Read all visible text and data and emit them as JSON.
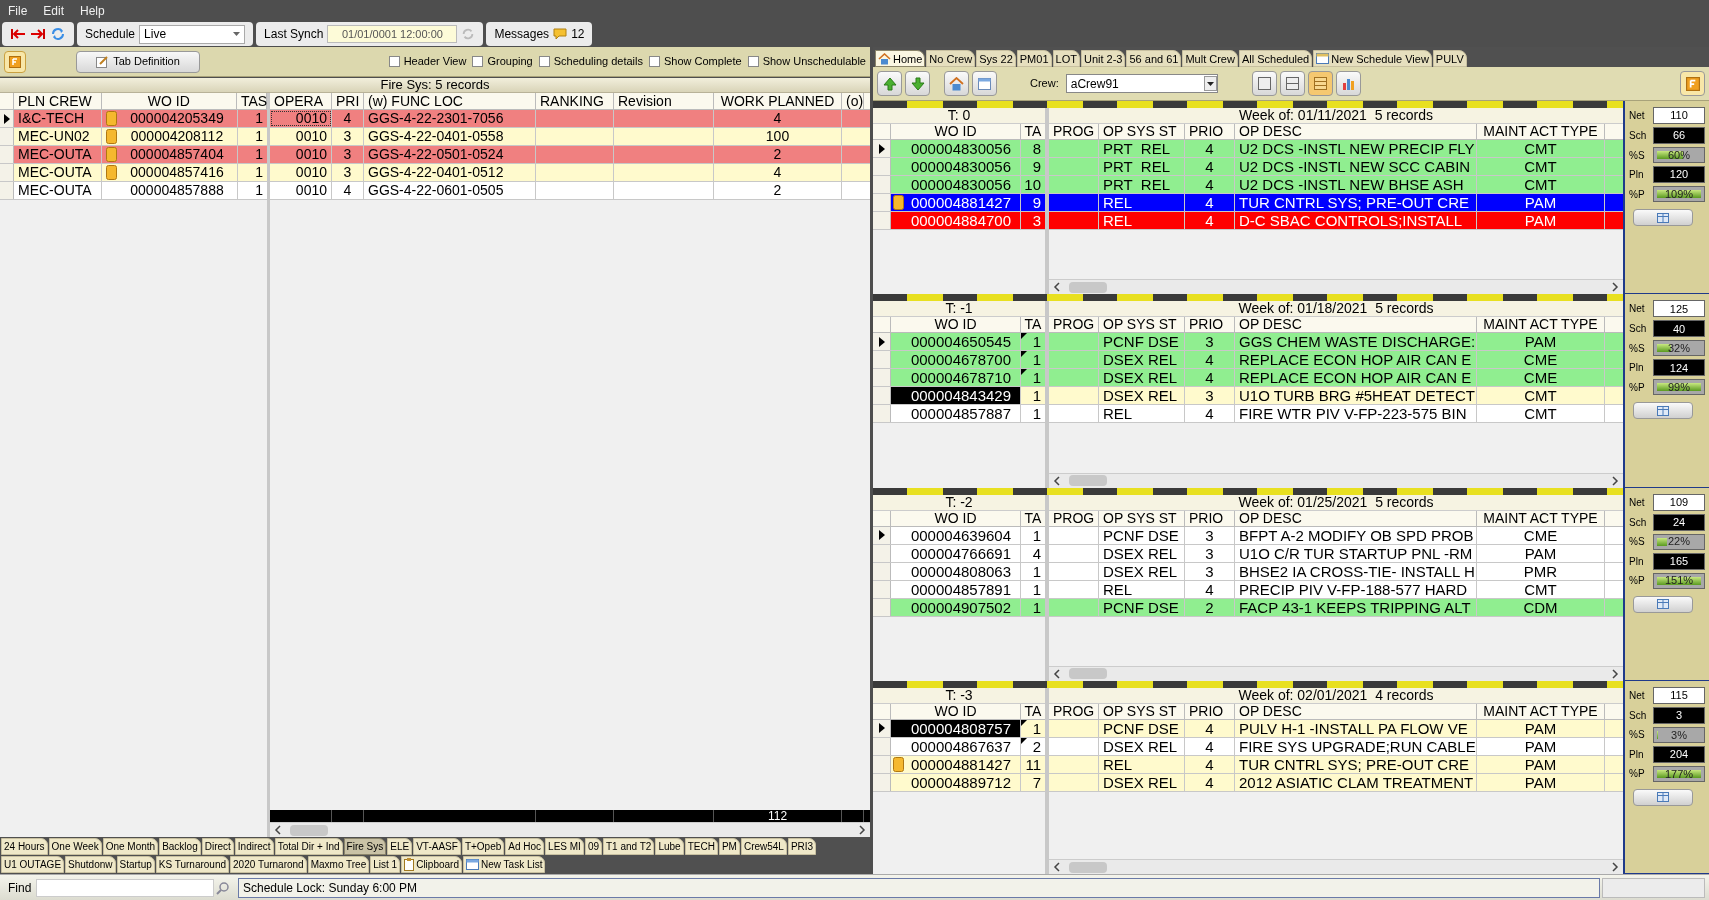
{
  "menu": [
    "File",
    "Edit",
    "Help"
  ],
  "toolbar": {
    "schedule_label": "Schedule",
    "schedule_value": "Live",
    "last_synch_label": "Last Synch",
    "last_synch_value": "01/01/0001 12:00:00",
    "messages_label": "Messages",
    "messages_count": "12"
  },
  "options": {
    "tab_definition": "Tab Definition",
    "checkboxes": [
      {
        "label": "Header View",
        "checked": false
      },
      {
        "label": "Grouping",
        "checked": false
      },
      {
        "label": "Scheduling details",
        "checked": false
      },
      {
        "label": "Show Complete",
        "checked": false
      },
      {
        "label": "Show Unschedulable",
        "checked": false
      }
    ]
  },
  "work_grid": {
    "title": "Fire Sys: 5 records",
    "frozen_columns": [
      "PLN CREW",
      "WO ID",
      "TAS"
    ],
    "columns": [
      "OPERA",
      "PRI",
      "(w) FUNC LOC",
      "RANKING",
      "Revision",
      "WORK PLANNED",
      "(o)"
    ],
    "rows": [
      {
        "crew": "I&C-TECH",
        "flag": true,
        "wo_id": "000004205349",
        "tas": "1",
        "opera": "0010",
        "pri": "4",
        "func_loc": "GGS-4-22-2301-7056",
        "work_planned": "4",
        "color": "#f08080",
        "current": true,
        "focused": true
      },
      {
        "crew": "MEC-UN02",
        "flag": true,
        "wo_id": "000004208112",
        "tas": "1",
        "opera": "0010",
        "pri": "3",
        "func_loc": "GGS-4-22-0401-0558",
        "work_planned": "100",
        "color": "#fffacd",
        "current": false,
        "focused": false
      },
      {
        "crew": "MEC-OUTA",
        "flag": true,
        "wo_id": "000004857404",
        "tas": "1",
        "opera": "0010",
        "pri": "3",
        "func_loc": "GGS-4-22-0501-0524",
        "work_planned": "2",
        "color": "#f08080",
        "current": false,
        "focused": false
      },
      {
        "crew": "MEC-OUTA",
        "flag": true,
        "wo_id": "000004857416",
        "tas": "1",
        "opera": "0010",
        "pri": "3",
        "func_loc": "GGS-4-22-0401-0512",
        "work_planned": "4",
        "color": "#fffacd",
        "current": false,
        "focused": false
      },
      {
        "crew": "MEC-OUTA",
        "flag": false,
        "wo_id": "000004857888",
        "tas": "1",
        "opera": "0010",
        "pri": "4",
        "func_loc": "GGS-4-22-0601-0505",
        "work_planned": "2",
        "color": "#ffffff",
        "current": false,
        "focused": false
      }
    ],
    "total_work_planned": "112"
  },
  "list_tabs": [
    [
      {
        "label": "24 Hours",
        "selected": false,
        "kind": "plain"
      },
      {
        "label": "One Week",
        "selected": false,
        "kind": "plain"
      },
      {
        "label": "One Month",
        "selected": false,
        "kind": "plain"
      },
      {
        "label": "Backlog",
        "selected": false,
        "kind": "plain"
      },
      {
        "label": "Direct",
        "selected": false,
        "kind": "plain"
      },
      {
        "label": "Indirect",
        "selected": false,
        "kind": "plain"
      },
      {
        "label": "Total Dir + Ind",
        "selected": false,
        "kind": "plain"
      },
      {
        "label": "Fire Sys",
        "selected": true,
        "kind": "plain"
      },
      {
        "label": "ELE",
        "selected": false,
        "kind": "plain"
      },
      {
        "label": "VT-AASF",
        "selected": false,
        "kind": "plain"
      },
      {
        "label": "T+Opeb",
        "selected": false,
        "kind": "plain"
      },
      {
        "label": "Ad Hoc",
        "selected": false,
        "kind": "plain"
      },
      {
        "label": "LES MI",
        "selected": false,
        "kind": "plain"
      },
      {
        "label": "09",
        "selected": false,
        "kind": "plain"
      },
      {
        "label": "T1 and T2",
        "selected": false,
        "kind": "plain"
      },
      {
        "label": "Lube",
        "selected": false,
        "kind": "plain"
      },
      {
        "label": "TECH",
        "selected": false,
        "kind": "plain"
      },
      {
        "label": "PM",
        "selected": false,
        "kind": "plain"
      },
      {
        "label": "Crew54L",
        "selected": false,
        "kind": "plain"
      },
      {
        "label": "PRI3",
        "selected": false,
        "kind": "plain"
      }
    ],
    [
      {
        "label": "U1 OUTAGE",
        "selected": false,
        "kind": "plain"
      },
      {
        "label": "Shutdonw",
        "selected": false,
        "kind": "plain"
      },
      {
        "label": "Startup",
        "selected": false,
        "kind": "plain"
      },
      {
        "label": "KS Turnaround",
        "selected": false,
        "kind": "plain"
      },
      {
        "label": "2020 Turnarond",
        "selected": false,
        "kind": "plain"
      },
      {
        "label": "Maxmo Tree",
        "selected": false,
        "kind": "plain"
      },
      {
        "label": "List 1",
        "selected": false,
        "kind": "plain"
      },
      {
        "label": "Clipboard",
        "selected": false,
        "kind": "clipboard"
      },
      {
        "label": "New Task List",
        "selected": false,
        "kind": "window"
      }
    ]
  ],
  "schedule_tabs": [
    {
      "label": "Home",
      "selected": true,
      "kind": "home"
    },
    {
      "label": "No Crew",
      "selected": false,
      "kind": "plain"
    },
    {
      "label": "Sys 22",
      "selected": false,
      "kind": "plain"
    },
    {
      "label": "PM01",
      "selected": false,
      "kind": "plain"
    },
    {
      "label": "LOT",
      "selected": false,
      "kind": "plain"
    },
    {
      "label": "Unit 2-3",
      "selected": false,
      "kind": "plain"
    },
    {
      "label": "56 and 61",
      "selected": false,
      "kind": "plain"
    },
    {
      "label": "Mult Crew",
      "selected": false,
      "kind": "plain"
    },
    {
      "label": "All Scheduled",
      "selected": false,
      "kind": "plain"
    },
    {
      "label": "New Schedule View",
      "selected": false,
      "kind": "window"
    },
    {
      "label": "PULV",
      "selected": false,
      "kind": "plain"
    }
  ],
  "crew": {
    "label": "Crew:",
    "value": "aCrew91"
  },
  "weeks": [
    {
      "title": "T: 0",
      "heading": "Week of: 01/11/2021  5 records",
      "frozen_columns": [
        "WO ID",
        "TA"
      ],
      "columns": [
        "PROG",
        "OP SYS ST",
        "PRIO",
        "OP DESC",
        "MAINT ACT TYPE"
      ],
      "stats": [
        {
          "kind": "value",
          "label": "Net",
          "value": "110"
        },
        {
          "kind": "dark",
          "label": "Sch",
          "value": "66"
        },
        {
          "kind": "bar",
          "label": "%S",
          "value": "60%",
          "level": 0.6
        },
        {
          "kind": "dark",
          "label": "Pln",
          "value": "120"
        },
        {
          "kind": "bar",
          "label": "%P",
          "value": "109%",
          "level": 1
        }
      ],
      "rows": [
        {
          "wo_id": "000004830056",
          "ta": "8",
          "op_sys_st": "PRT  REL",
          "prio": "4",
          "op_desc": "U2 DCS -INSTL NEW PRECIP FLY",
          "maint_act_type": "CMT",
          "color": "#90ee90",
          "current": true,
          "flag": false,
          "wo_selected": false,
          "note": false
        },
        {
          "wo_id": "000004830056",
          "ta": "9",
          "op_sys_st": "PRT  REL",
          "prio": "4",
          "op_desc": "U2 DCS -INSTL NEW SCC CABIN",
          "maint_act_type": "CMT",
          "color": "#90ee90",
          "current": false,
          "flag": false,
          "wo_selected": false,
          "note": false
        },
        {
          "wo_id": "000004830056",
          "ta": "10",
          "op_sys_st": "PRT  REL",
          "prio": "4",
          "op_desc": "U2 DCS -INSTL NEW BHSE ASH",
          "maint_act_type": "CMT",
          "color": "#90ee90",
          "current": false,
          "flag": false,
          "wo_selected": false,
          "note": false
        },
        {
          "wo_id": "000004881427",
          "ta": "9",
          "op_sys_st": "REL",
          "prio": "4",
          "op_desc": "TUR CNTRL SYS; PRE-OUT CRE",
          "maint_act_type": "PAM",
          "color": "#0000ff",
          "current": false,
          "flag": true,
          "wo_selected": false,
          "note": false
        },
        {
          "wo_id": "000004884700",
          "ta": "3",
          "op_sys_st": "REL",
          "prio": "4",
          "op_desc": "D-C SBAC CONTROLS;INSTALL",
          "maint_act_type": "PAM",
          "color": "#ff0000",
          "current": false,
          "flag": false,
          "wo_selected": false,
          "note": false
        }
      ]
    },
    {
      "title": "T: -1",
      "heading": "Week of: 01/18/2021  5 records",
      "frozen_columns": [
        "WO ID",
        "TA"
      ],
      "columns": [
        "PROG",
        "OP SYS ST",
        "PRIO",
        "OP DESC",
        "MAINT ACT TYPE"
      ],
      "stats": [
        {
          "kind": "value",
          "label": "Net",
          "value": "125"
        },
        {
          "kind": "dark",
          "label": "Sch",
          "value": "40"
        },
        {
          "kind": "bar",
          "label": "%S",
          "value": "32%",
          "level": 0.32
        },
        {
          "kind": "dark",
          "label": "Pln",
          "value": "124"
        },
        {
          "kind": "bar",
          "label": "%P",
          "value": "99%",
          "level": 0.99
        }
      ],
      "rows": [
        {
          "wo_id": "000004650545",
          "ta": "1",
          "op_sys_st": "PCNF DSE",
          "prio": "3",
          "op_desc": "GGS CHEM WASTE DISCHARGE:",
          "maint_act_type": "PAM",
          "color": "#90ee90",
          "current": true,
          "flag": false,
          "wo_selected": false,
          "note": true
        },
        {
          "wo_id": "000004678700",
          "ta": "1",
          "op_sys_st": "DSEX REL",
          "prio": "4",
          "op_desc": "REPLACE ECON HOP AIR CAN E",
          "maint_act_type": "CME",
          "color": "#90ee90",
          "current": false,
          "flag": false,
          "wo_selected": false,
          "note": true
        },
        {
          "wo_id": "000004678710",
          "ta": "1",
          "op_sys_st": "DSEX REL",
          "prio": "4",
          "op_desc": "REPLACE ECON HOP AIR CAN E",
          "maint_act_type": "CME",
          "color": "#90ee90",
          "current": false,
          "flag": false,
          "wo_selected": false,
          "note": true
        },
        {
          "wo_id": "000004843429",
          "ta": "1",
          "op_sys_st": "DSEX REL",
          "prio": "3",
          "op_desc": "U1O TURB BRG #5HEAT DETECT",
          "maint_act_type": "CMT",
          "color": "#fffacd",
          "current": false,
          "flag": false,
          "wo_selected": true,
          "note": false
        },
        {
          "wo_id": "000004857887",
          "ta": "1",
          "op_sys_st": "REL",
          "prio": "4",
          "op_desc": "FIRE WTR PIV V-FP-223-575 BIN",
          "maint_act_type": "CMT",
          "color": "#ffffff",
          "current": false,
          "flag": false,
          "wo_selected": false,
          "note": false
        }
      ]
    },
    {
      "title": "T: -2",
      "heading": "Week of: 01/25/2021  5 records",
      "frozen_columns": [
        "WO ID",
        "TA"
      ],
      "columns": [
        "PROG",
        "OP SYS ST",
        "PRIO",
        "OP DESC",
        "MAINT ACT TYPE"
      ],
      "stats": [
        {
          "kind": "value",
          "label": "Net",
          "value": "109"
        },
        {
          "kind": "dark",
          "label": "Sch",
          "value": "24"
        },
        {
          "kind": "bar",
          "label": "%S",
          "value": "22%",
          "level": 0.22
        },
        {
          "kind": "dark",
          "label": "Pln",
          "value": "165"
        },
        {
          "kind": "bar",
          "label": "%P",
          "value": "151%",
          "level": 1
        }
      ],
      "rows": [
        {
          "wo_id": "000004639604",
          "ta": "1",
          "op_sys_st": "PCNF DSE",
          "prio": "3",
          "op_desc": "BFPT A-2 MODIFY OB SPD PROB",
          "maint_act_type": "CME",
          "color": "#ffffff",
          "current": true,
          "flag": false,
          "wo_selected": false,
          "note": false
        },
        {
          "wo_id": "000004766691",
          "ta": "4",
          "op_sys_st": "DSEX REL",
          "prio": "3",
          "op_desc": "U1O C/R TUR STARTUP PNL -RM",
          "maint_act_type": "PAM",
          "color": "#ffffff",
          "current": false,
          "flag": false,
          "wo_selected": false,
          "note": false
        },
        {
          "wo_id": "000004808063",
          "ta": "1",
          "op_sys_st": "DSEX REL",
          "prio": "3",
          "op_desc": "BHSE2 IA CROSS-TIE- INSTALL H",
          "maint_act_type": "PMR",
          "color": "#ffffff",
          "current": false,
          "flag": false,
          "wo_selected": false,
          "note": false
        },
        {
          "wo_id": "000004857891",
          "ta": "1",
          "op_sys_st": "REL",
          "prio": "4",
          "op_desc": "PRECIP PIV V-FP-188-577 HARD",
          "maint_act_type": "CMT",
          "color": "#ffffff",
          "current": false,
          "flag": false,
          "wo_selected": false,
          "note": false
        },
        {
          "wo_id": "000004907502",
          "ta": "1",
          "op_sys_st": "PCNF DSE",
          "prio": "2",
          "op_desc": "FACP 43-1 KEEPS TRIPPING ALT",
          "maint_act_type": "CDM",
          "color": "#90ee90",
          "current": false,
          "flag": false,
          "wo_selected": false,
          "note": false
        }
      ]
    },
    {
      "title": "T: -3",
      "heading": "Week of: 02/01/2021  4 records",
      "frozen_columns": [
        "WO ID",
        "TA"
      ],
      "columns": [
        "PROG",
        "OP SYS ST",
        "PRIO",
        "OP DESC",
        "MAINT ACT TYPE"
      ],
      "stats": [
        {
          "kind": "value",
          "label": "Net",
          "value": "115"
        },
        {
          "kind": "dark",
          "label": "Sch",
          "value": "3"
        },
        {
          "kind": "bar",
          "label": "%S",
          "value": "3%",
          "level": 0.03
        },
        {
          "kind": "dark",
          "label": "Pln",
          "value": "204"
        },
        {
          "kind": "bar",
          "label": "%P",
          "value": "177%",
          "level": 1
        }
      ],
      "rows": [
        {
          "wo_id": "000004808757",
          "ta": "1",
          "op_sys_st": "PCNF DSE",
          "prio": "4",
          "op_desc": "PULV H-1 -INSTALL PA FLOW VE",
          "maint_act_type": "PAM",
          "color": "#fffacd",
          "current": true,
          "flag": false,
          "wo_selected": true,
          "note": true
        },
        {
          "wo_id": "000004867637",
          "ta": "2",
          "op_sys_st": "DSEX REL",
          "prio": "4",
          "op_desc": "FIRE SYS UPGRADE;RUN CABLE",
          "maint_act_type": "PAM",
          "color": "#ffffff",
          "current": false,
          "flag": false,
          "wo_selected": false,
          "note": true
        },
        {
          "wo_id": "000004881427",
          "ta": "11",
          "op_sys_st": "REL",
          "prio": "4",
          "op_desc": "TUR CNTRL SYS; PRE-OUT CRE",
          "maint_act_type": "PAM",
          "color": "#fffacd",
          "current": false,
          "flag": true,
          "wo_selected": false,
          "note": false
        },
        {
          "wo_id": "000004889712",
          "ta": "7",
          "op_sys_st": "DSEX REL",
          "prio": "4",
          "op_desc": "2012 ASIATIC CLAM TREATMENT",
          "maint_act_type": "PAM",
          "color": "#fffacd",
          "current": false,
          "flag": false,
          "wo_selected": false,
          "note": false
        }
      ]
    }
  ],
  "find": {
    "label": "Find"
  },
  "status": "Schedule Lock: Sunday 6:00 PM"
}
